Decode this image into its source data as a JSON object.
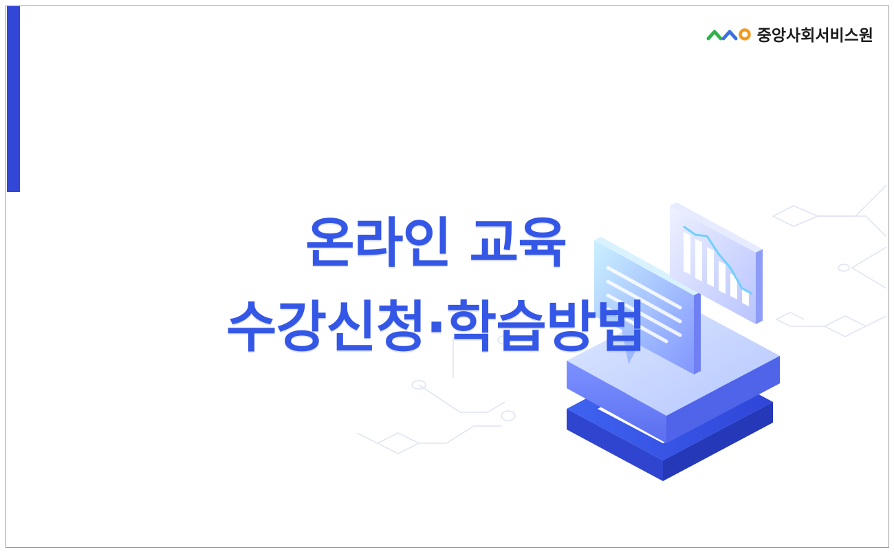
{
  "header": {
    "org_name": "중앙사회서비스원",
    "logo_mark_colors": [
      "#2fb24c",
      "#3d6fe0",
      "#f39a1b"
    ]
  },
  "slide": {
    "title_line1": "온라인 교육",
    "title_line2": "수강신청·학습방법"
  },
  "colors": {
    "accent": "#3347d6",
    "title": "#3557e6"
  },
  "illustration": {
    "subject": "isometric screen with chart and chat bubble"
  }
}
